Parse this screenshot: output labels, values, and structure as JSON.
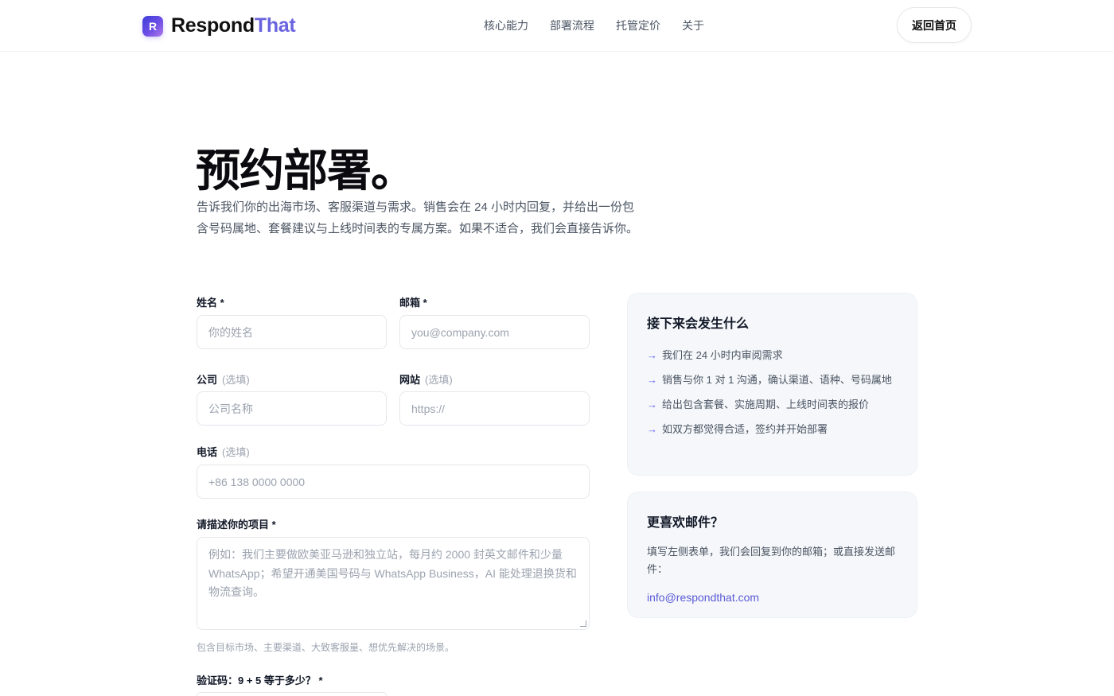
{
  "header": {
    "logo_mark": "R",
    "logo_text_main": "Respond",
    "logo_text_accent": "That",
    "nav": [
      "核心能力",
      "部署流程",
      "托管定价",
      "关于"
    ],
    "home_button": "返回首页"
  },
  "hero": {
    "title": "预约部署。",
    "lead": "告诉我们你的出海市场、客服渠道与需求。销售会在 24 小时内回复，并给出一份包含号码属地、套餐建议与上线时间表的专属方案。如果不适合，我们会直接告诉你。"
  },
  "form": {
    "name": {
      "label": "姓名",
      "required_mark": "*",
      "placeholder": "你的姓名"
    },
    "email": {
      "label": "邮箱",
      "required_mark": "*",
      "placeholder": "you@company.com"
    },
    "company": {
      "label": "公司",
      "optional": "(选填)",
      "placeholder": "公司名称"
    },
    "website": {
      "label": "网站",
      "optional": "(选填)",
      "placeholder": "https://"
    },
    "phone": {
      "label": "电话",
      "optional": "(选填)",
      "placeholder": "+86 138 0000 0000"
    },
    "project": {
      "label": "请描述你的项目",
      "required_mark": "*",
      "placeholder": "例如：我们主要做欧美亚马逊和独立站，每月约 2000 封英文邮件和少量 WhatsApp；希望开通美国号码与 WhatsApp Business，AI 能处理退换货和物流查询。",
      "hint": "包含目标市场、主要渠道、大致客服量、想优先解决的场景。"
    },
    "captcha": {
      "label": "验证码：9 + 5 等于多少？",
      "required_mark": "*"
    }
  },
  "next_steps": {
    "title": "接下来会发生什么",
    "items": [
      "我们在 24 小时内审阅需求",
      "销售与你 1 对 1 沟通，确认渠道、语种、号码属地",
      "给出包含套餐、实施周期、上线时间表的报价",
      "如双方都觉得合适，签约并开始部署"
    ]
  },
  "prefer_email": {
    "title": "更喜欢邮件？",
    "text": "填写左侧表单，我们会回复到你的邮箱；或直接发送邮件：",
    "email": "info@respondthat.com"
  },
  "colors": {
    "accent": "#6366f1",
    "link": "#5b5bd6",
    "card_bg": "#f5f7fa"
  },
  "icons": {
    "step_arrow": "arrow-right-icon"
  }
}
